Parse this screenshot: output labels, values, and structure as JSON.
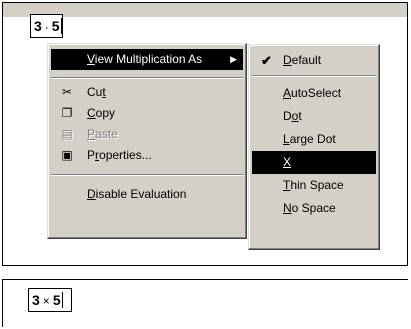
{
  "top_panel": {
    "expression": {
      "left": "3",
      "operator": "·",
      "right": "5"
    }
  },
  "context_menu": {
    "items": [
      {
        "label": "View Multiplication As",
        "has_submenu": true,
        "highlighted": true
      },
      {
        "label": "Cut",
        "icon": "scissors-icon"
      },
      {
        "label": "Copy",
        "icon": "copy-icon"
      },
      {
        "label": "Paste",
        "icon": "clipboard-icon",
        "disabled": true
      },
      {
        "label": "Properties...",
        "icon": "properties-icon"
      },
      {
        "label": "Disable Evaluation"
      }
    ]
  },
  "submenu": {
    "items": [
      {
        "label": "Default",
        "checked": true
      },
      {
        "label": "AutoSelect"
      },
      {
        "label": "Dot"
      },
      {
        "label": "Large Dot"
      },
      {
        "label": "X",
        "highlighted": true
      },
      {
        "label": "Thin Space"
      },
      {
        "label": "No Space"
      }
    ]
  },
  "bottom_panel": {
    "expression": {
      "left": "3",
      "operator": "×",
      "right": "5"
    }
  }
}
